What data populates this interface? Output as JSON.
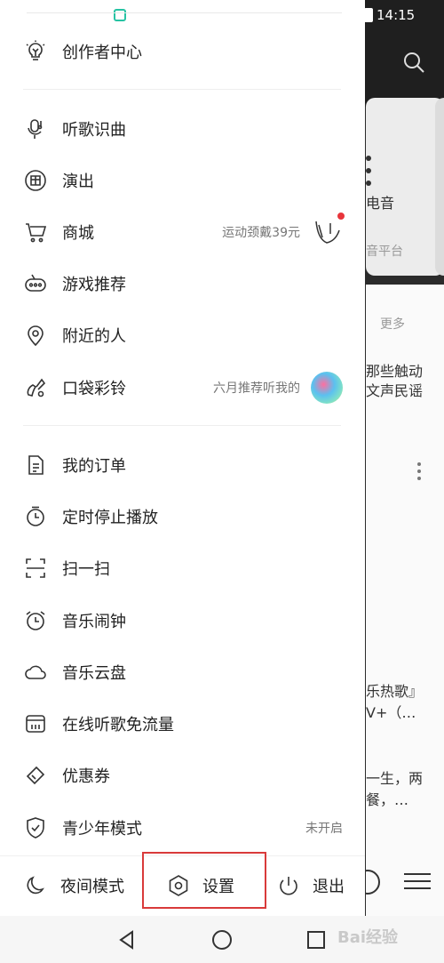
{
  "status_bar": {
    "time": "14:15"
  },
  "background": {
    "snippets": [
      "电音",
      "音平台",
      "更多",
      "那些触动",
      "文声民谣",
      "乐热歌』",
      "V+（…",
      "一生，两",
      "餐，…"
    ]
  },
  "drawer": {
    "creator": {
      "label": "创作者中心",
      "icon": "lightbulb-icon"
    },
    "group1": [
      {
        "label": "听歌识曲",
        "icon": "mic-music-icon"
      },
      {
        "label": "演出",
        "icon": "ticket-icon"
      },
      {
        "label": "商城",
        "icon": "cart-icon",
        "extra": "运动颈戴39元"
      },
      {
        "label": "游戏推荐",
        "icon": "gamepad-icon"
      },
      {
        "label": "附近的人",
        "icon": "location-icon"
      },
      {
        "label": "口袋彩铃",
        "icon": "ringtone-icon",
        "extra": "六月推荐听我的"
      }
    ],
    "group2": [
      {
        "label": "我的订单",
        "icon": "order-icon"
      },
      {
        "label": "定时停止播放",
        "icon": "timer-icon"
      },
      {
        "label": "扫一扫",
        "icon": "scan-icon"
      },
      {
        "label": "音乐闹钟",
        "icon": "alarm-icon"
      },
      {
        "label": "音乐云盘",
        "icon": "cloud-icon"
      },
      {
        "label": "在线听歌免流量",
        "icon": "sim-icon"
      },
      {
        "label": "优惠券",
        "icon": "coupon-icon"
      },
      {
        "label": "青少年模式",
        "icon": "shield-icon",
        "extra": "未开启"
      }
    ],
    "bottom": {
      "night": "夜间模式",
      "settings": "设置",
      "logout": "退出"
    }
  },
  "watermark": "Bai经验",
  "colors": {
    "highlight": "#d93a3a",
    "badge": "#e8353b"
  }
}
